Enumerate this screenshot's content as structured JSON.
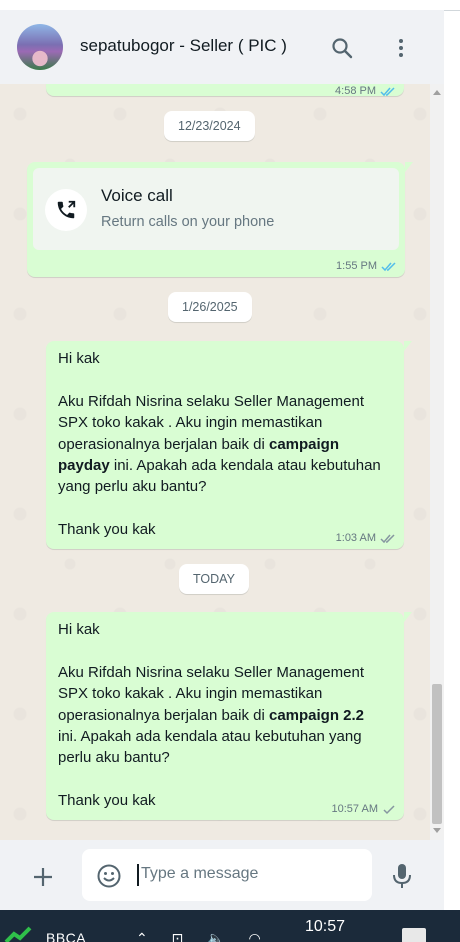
{
  "header": {
    "title": "sepatubogor - Seller ( PIC )"
  },
  "messages": [
    {
      "type": "partial",
      "time": "4:58 PM",
      "status": "read"
    },
    {
      "type": "date",
      "label": "12/23/2024"
    },
    {
      "type": "call",
      "title": "Voice call",
      "subtitle": "Return calls on your phone",
      "time": "1:55 PM",
      "status": "read"
    },
    {
      "type": "date",
      "label": "1/26/2025"
    },
    {
      "type": "text",
      "lines": [
        "Hi kak",
        "",
        "Aku Rifdah Nisrina selaku Seller Management",
        "SPX toko kakak . Aku ingin memastikan",
        "operasionalnya berjalan baik di ",
        "campaign",
        "payday",
        " ini. Apakah ada kendala atau kebutuhan",
        "yang perlu aku bantu?",
        "",
        "Thank you kak"
      ],
      "time": "1:03 AM",
      "status": "read"
    },
    {
      "type": "date",
      "label": "TODAY"
    },
    {
      "type": "text",
      "lines": [
        "Hi kak",
        "",
        "Aku Rifdah Nisrina selaku Seller Management",
        "SPX toko kakak . Aku ingin memastikan",
        "operasionalnya berjalan baik di ",
        "campaign 2.2",
        "ini. Apakah ada kendala atau kebutuhan yang",
        "perlu aku bantu?",
        "",
        "Thank you kak"
      ],
      "time": "10:57 AM",
      "status": "sent"
    }
  ],
  "composer": {
    "placeholder": "Type a message"
  },
  "taskbar": {
    "ticker": "BBCA",
    "time": "10:57"
  },
  "colors": {
    "outgoing_bubble": "#d9fdd3",
    "chat_background": "#efeae2",
    "read_ticks": "#53bdeb",
    "header": "#f0f2f5"
  },
  "icons": [
    "search-icon",
    "menu-icon",
    "phone-call-icon",
    "double-check-icon",
    "check-icon",
    "plus-icon",
    "emoji-icon",
    "mic-icon"
  ]
}
